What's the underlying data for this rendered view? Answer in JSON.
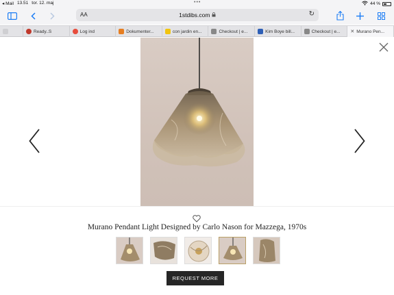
{
  "status_bar": {
    "carrier": "◂ Mail",
    "time": "13.51",
    "date": "tor. 12. maj",
    "battery": "44 %"
  },
  "toolbar": {
    "url_aa": "AA",
    "url_host": "1stdibs.com"
  },
  "tabs": [
    {
      "label": "",
      "color": "#cfcfd2"
    },
    {
      "label": "Ready..S",
      "color": "#c0392b"
    },
    {
      "label": "Log ind",
      "color": "#e74c3c"
    },
    {
      "label": "Dokumenter...",
      "color": "#e67e22"
    },
    {
      "label": "con jardin en...",
      "color": "#f1c40f"
    },
    {
      "label": "Checkout | e...",
      "color": "#888888"
    },
    {
      "label": "Kim Boye bill...",
      "color": "#2e5fb6"
    },
    {
      "label": "Checkout | e...",
      "color": "#888888"
    },
    {
      "label": "Murano Pen...",
      "color": "#555555"
    }
  ],
  "product": {
    "title": "Murano Pendant Light Designed by Carlo Nason for Mazzega, 1970s",
    "request_label": "REQUEST MORE"
  },
  "thumbnails": [
    {
      "name": "thumb-1",
      "active": false
    },
    {
      "name": "thumb-2",
      "active": false
    },
    {
      "name": "thumb-3",
      "active": false
    },
    {
      "name": "thumb-4",
      "active": true
    },
    {
      "name": "thumb-5",
      "active": false
    }
  ],
  "colors": {
    "accent": "#1a7cf5",
    "button_bg": "#262626",
    "active_thumb_border": "#b99f66"
  }
}
